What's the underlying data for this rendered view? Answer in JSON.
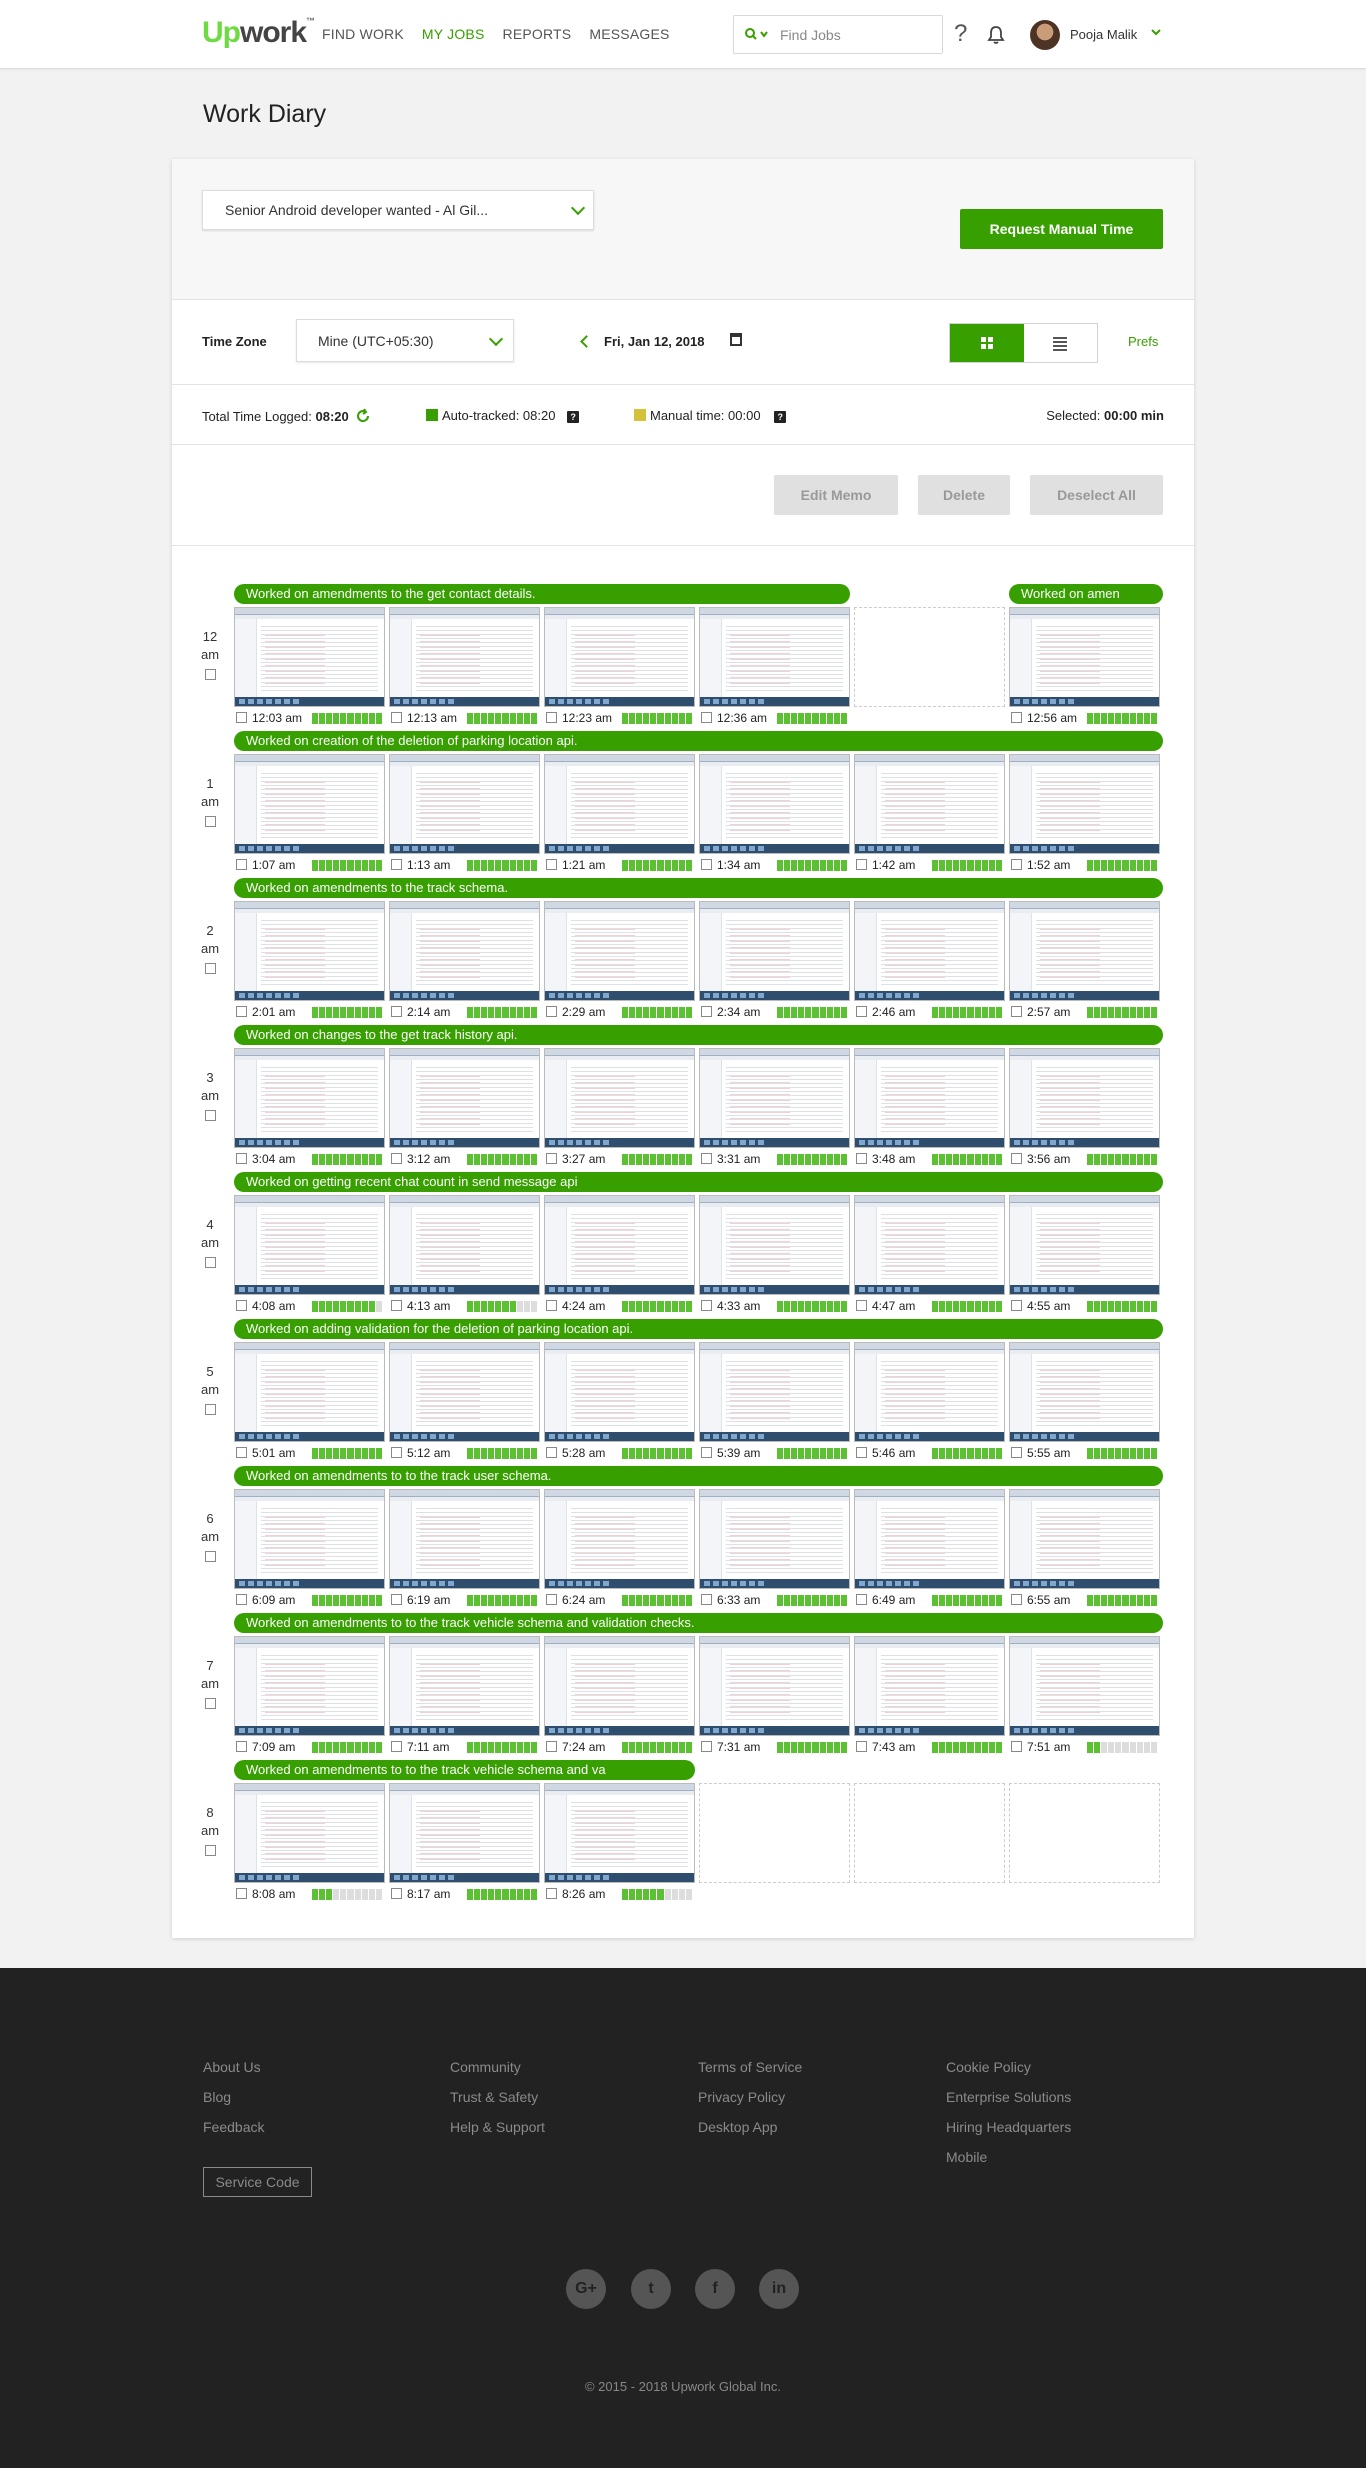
{
  "header": {
    "logo": {
      "up": "Up",
      "rest": "work",
      "tm": "™"
    },
    "nav": [
      "FIND WORK",
      "MY JOBS",
      "REPORTS",
      "MESSAGES"
    ],
    "active_nav": "MY JOBS",
    "search_placeholder": "Find Jobs",
    "help_label": "?",
    "user_name": "Pooja Malik",
    "icons": [
      "search-icon",
      "chevron-down-icon",
      "help-icon",
      "bell-icon",
      "avatar"
    ]
  },
  "page": {
    "title": "Work Diary"
  },
  "contract": {
    "selected": "Senior Android developer wanted - Al Gil..."
  },
  "actions": {
    "request_manual_time": "Request Manual Time",
    "edit_memo": "Edit Memo",
    "delete": "Delete",
    "deselect_all": "Deselect All"
  },
  "filters": {
    "time_zone_label": "Time Zone",
    "time_zone_value": "Mine (UTC+05:30)",
    "date": "Fri, Jan 12, 2018",
    "prefs": "Prefs",
    "view_mode": "grid"
  },
  "stats": {
    "total_label": "Total Time Logged:",
    "total_value": "08:20",
    "auto_label": "Auto-tracked: 08:20",
    "manual_label": "Manual time: 00:00",
    "selected_label": "Selected:",
    "selected_value": "00:00 min",
    "colors": {
      "brand": "#37a000",
      "auto": "#37a000",
      "manual": "#d4c23a",
      "activity": "#5cc132"
    }
  },
  "diary": [
    {
      "hour": "12",
      "ampm": "am",
      "memos": [
        {
          "text": "Worked on amendments to the get contact details.",
          "start": 0,
          "span": 4
        },
        {
          "text": "Worked on amen",
          "start": 5,
          "span": 1
        }
      ],
      "cells": [
        {
          "time": "12:03 am",
          "activity": 10
        },
        {
          "time": "12:13 am",
          "activity": 10
        },
        {
          "time": "12:23 am",
          "activity": 10
        },
        {
          "time": "12:36 am",
          "activity": 10
        },
        null,
        {
          "time": "12:56 am",
          "activity": 10
        }
      ]
    },
    {
      "hour": "1",
      "ampm": "am",
      "memos": [
        {
          "text": "Worked on creation of the deletion of parking location api.",
          "start": 0,
          "span": 6
        }
      ],
      "cells": [
        {
          "time": "1:07 am",
          "activity": 10
        },
        {
          "time": "1:13 am",
          "activity": 10
        },
        {
          "time": "1:21 am",
          "activity": 10
        },
        {
          "time": "1:34 am",
          "activity": 10
        },
        {
          "time": "1:42 am",
          "activity": 10
        },
        {
          "time": "1:52 am",
          "activity": 10
        }
      ]
    },
    {
      "hour": "2",
      "ampm": "am",
      "memos": [
        {
          "text": "Worked on amendments to the track schema.",
          "start": 0,
          "span": 6
        }
      ],
      "cells": [
        {
          "time": "2:01 am",
          "activity": 10
        },
        {
          "time": "2:14 am",
          "activity": 10
        },
        {
          "time": "2:29 am",
          "activity": 10
        },
        {
          "time": "2:34 am",
          "activity": 10
        },
        {
          "time": "2:46 am",
          "activity": 10
        },
        {
          "time": "2:57 am",
          "activity": 10
        }
      ]
    },
    {
      "hour": "3",
      "ampm": "am",
      "memos": [
        {
          "text": "Worked on changes to the get track history api.",
          "start": 0,
          "span": 6
        }
      ],
      "cells": [
        {
          "time": "3:04 am",
          "activity": 10
        },
        {
          "time": "3:12 am",
          "activity": 10
        },
        {
          "time": "3:27 am",
          "activity": 10
        },
        {
          "time": "3:31 am",
          "activity": 10
        },
        {
          "time": "3:48 am",
          "activity": 10
        },
        {
          "time": "3:56 am",
          "activity": 10
        }
      ]
    },
    {
      "hour": "4",
      "ampm": "am",
      "memos": [
        {
          "text": "Worked on getting recent chat count in send message api",
          "start": 0,
          "span": 6
        }
      ],
      "cells": [
        {
          "time": "4:08 am",
          "activity": 9
        },
        {
          "time": "4:13 am",
          "activity": 7
        },
        {
          "time": "4:24 am",
          "activity": 10
        },
        {
          "time": "4:33 am",
          "activity": 10
        },
        {
          "time": "4:47 am",
          "activity": 10
        },
        {
          "time": "4:55 am",
          "activity": 10
        }
      ]
    },
    {
      "hour": "5",
      "ampm": "am",
      "memos": [
        {
          "text": "Worked on adding validation for the deletion of parking location api.",
          "start": 0,
          "span": 6
        }
      ],
      "cells": [
        {
          "time": "5:01 am",
          "activity": 10
        },
        {
          "time": "5:12 am",
          "activity": 10
        },
        {
          "time": "5:28 am",
          "activity": 10
        },
        {
          "time": "5:39 am",
          "activity": 10
        },
        {
          "time": "5:46 am",
          "activity": 10
        },
        {
          "time": "5:55 am",
          "activity": 10
        }
      ]
    },
    {
      "hour": "6",
      "ampm": "am",
      "memos": [
        {
          "text": "Worked on amendments to to the track user schema.",
          "start": 0,
          "span": 6
        }
      ],
      "cells": [
        {
          "time": "6:09 am",
          "activity": 10
        },
        {
          "time": "6:19 am",
          "activity": 10
        },
        {
          "time": "6:24 am",
          "activity": 10
        },
        {
          "time": "6:33 am",
          "activity": 10
        },
        {
          "time": "6:49 am",
          "activity": 10
        },
        {
          "time": "6:55 am",
          "activity": 10
        }
      ]
    },
    {
      "hour": "7",
      "ampm": "am",
      "memos": [
        {
          "text": "Worked on amendments to to the track vehicle schema and validation checks.",
          "start": 0,
          "span": 6
        }
      ],
      "cells": [
        {
          "time": "7:09 am",
          "activity": 10
        },
        {
          "time": "7:11 am",
          "activity": 10
        },
        {
          "time": "7:24 am",
          "activity": 10
        },
        {
          "time": "7:31 am",
          "activity": 10
        },
        {
          "time": "7:43 am",
          "activity": 10
        },
        {
          "time": "7:51 am",
          "activity": 2
        }
      ]
    },
    {
      "hour": "8",
      "ampm": "am",
      "memos": [
        {
          "text": "Worked on amendments to to the track vehicle schema and va",
          "start": 0,
          "span": 3
        }
      ],
      "cells": [
        {
          "time": "8:08 am",
          "activity": 3
        },
        {
          "time": "8:17 am",
          "activity": 10
        },
        {
          "time": "8:26 am",
          "activity": 6
        },
        null,
        null,
        null
      ]
    }
  ],
  "footer": {
    "columns": [
      [
        "About Us",
        "Blog",
        "Feedback"
      ],
      [
        "Community",
        "Trust & Safety",
        "Help & Support"
      ],
      [
        "Terms of Service",
        "Privacy Policy",
        "Desktop App"
      ],
      [
        "Cookie Policy",
        "Enterprise Solutions",
        "Hiring Headquarters",
        "Mobile"
      ]
    ],
    "service_code": "Service Code",
    "social": [
      {
        "name": "google-plus-icon",
        "glyph": "G+"
      },
      {
        "name": "twitter-icon",
        "glyph": "t"
      },
      {
        "name": "facebook-icon",
        "glyph": "f"
      },
      {
        "name": "linkedin-icon",
        "glyph": "in"
      }
    ],
    "copyright": "© 2015 - 2018 Upwork Global Inc."
  }
}
